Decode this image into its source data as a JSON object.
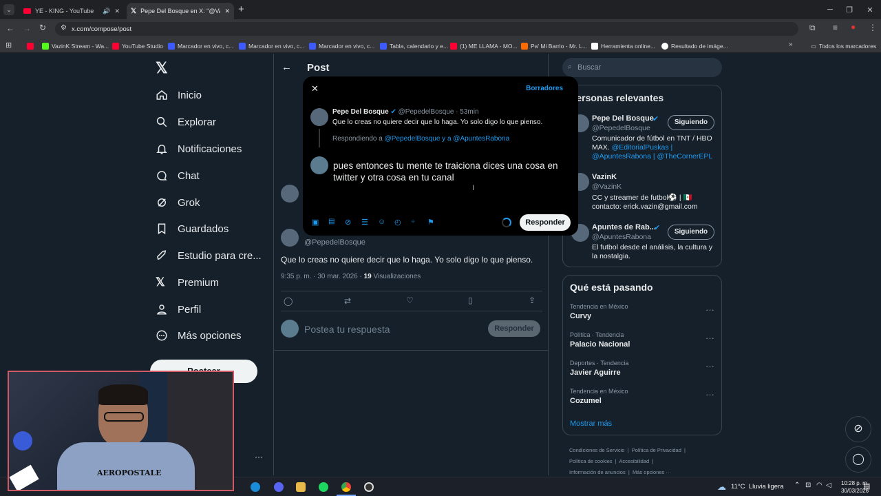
{
  "browser": {
    "tabs": [
      {
        "title": "YE - KING - YouTube"
      },
      {
        "title": "Pepe Del Bosque en X: \"@VazinK"
      }
    ],
    "url": "x.com/compose/post",
    "bookmarks": [
      "VazinK Stream - Wa...",
      "YouTube Studio",
      "Marcador en vivo, c...",
      "Marcador en vivo, c...",
      "Marcador en vivo, c...",
      "Tabla, calendario y e...",
      "(1) ME LLAMA - MO...",
      "Pa' Mi Barrio - Mr. L...",
      "Herramienta online...",
      "Resultado de imáge..."
    ],
    "all_bookmarks": "Todos los marcadores"
  },
  "nav": {
    "items": [
      "Inicio",
      "Explorar",
      "Notificaciones",
      "Chat",
      "Grok",
      "Guardados",
      "Estudio para cre...",
      "Premium",
      "Perfil",
      "Más opciones"
    ],
    "post_button": "Postear"
  },
  "main": {
    "header": "Post",
    "tweet": {
      "handle": "@PepedelBosque",
      "text": "Que lo creas no quiere decir que lo haga. Yo solo digo lo que pienso.",
      "time": "9:35 p. m. · 30 mar. 2026 · ",
      "views_count": "19",
      "views_label": " Visualizaciones"
    },
    "reply_placeholder": "Postea tu respuesta",
    "reply_button": "Responder"
  },
  "modal": {
    "drafts": "Borradores",
    "original": {
      "name": "Pepe Del Bosque",
      "handle": "@PepedelBosque · 53min",
      "text": "Que lo creas no quiere decir que lo haga. Yo solo digo lo que pienso."
    },
    "replying_prefix": "Respondiendo a ",
    "replying_to": "@PepedelBosque y a @ApuntesRabona",
    "draft_text": "pues entonces tu mente te traiciona dices una cosa en twitter y otra cosa en tu canal",
    "reply_button": "Responder"
  },
  "right": {
    "search_placeholder": "Buscar",
    "relevant": {
      "title": "Personas relevantes",
      "people": [
        {
          "name": "Pepe Del Bosque",
          "handle": "@PepedelBosque",
          "bio_plain": "Comunicador de fútbol en TNT / HBO MAX. ",
          "bio_links": "@EditorialPuskas | @ApuntesRabona | @TheCornerEPL",
          "button": "Siguiendo"
        },
        {
          "name": "VazinK",
          "handle": "@VazinK",
          "bio_plain": "CC y streamer de futbol⚽ | 🇲🇽 contacto: erick.vazin@gmail.com",
          "bio_links": "",
          "button": ""
        },
        {
          "name": "Apuntes de Rab...",
          "handle": "@ApuntesRabona",
          "bio_plain": "El futbol desde el análisis, la cultura y la nostalgia.",
          "bio_links": "",
          "button": "Siguiendo"
        }
      ]
    },
    "trends": {
      "title": "Qué está pasando",
      "items": [
        {
          "context": "Tendencia en México",
          "name": "Curvy"
        },
        {
          "context": "Política · Tendencia",
          "name": "Palacio Nacional"
        },
        {
          "context": "Deportes · Tendencia",
          "name": "Javier Aguirre"
        },
        {
          "context": "Tendencia en México",
          "name": "Cozumel"
        }
      ],
      "more": "Mostrar más"
    },
    "footer": {
      "line1": [
        "Condiciones de Servicio",
        "Política de Privacidad"
      ],
      "line2": [
        "Política de cookies",
        "Accesibilidad"
      ],
      "line3": [
        "Información de anuncios",
        "Más opciones ···"
      ]
    }
  },
  "webcam": {
    "shirt_text": "AEROPOSTALE"
  },
  "taskbar": {
    "weather": "11°C  Lluvia ligera",
    "time": "10:28 p. m.",
    "date": "30/03/2026"
  },
  "colors": {
    "accent": "#1d9bf0",
    "background": "#15202b",
    "modal": "#000000"
  }
}
